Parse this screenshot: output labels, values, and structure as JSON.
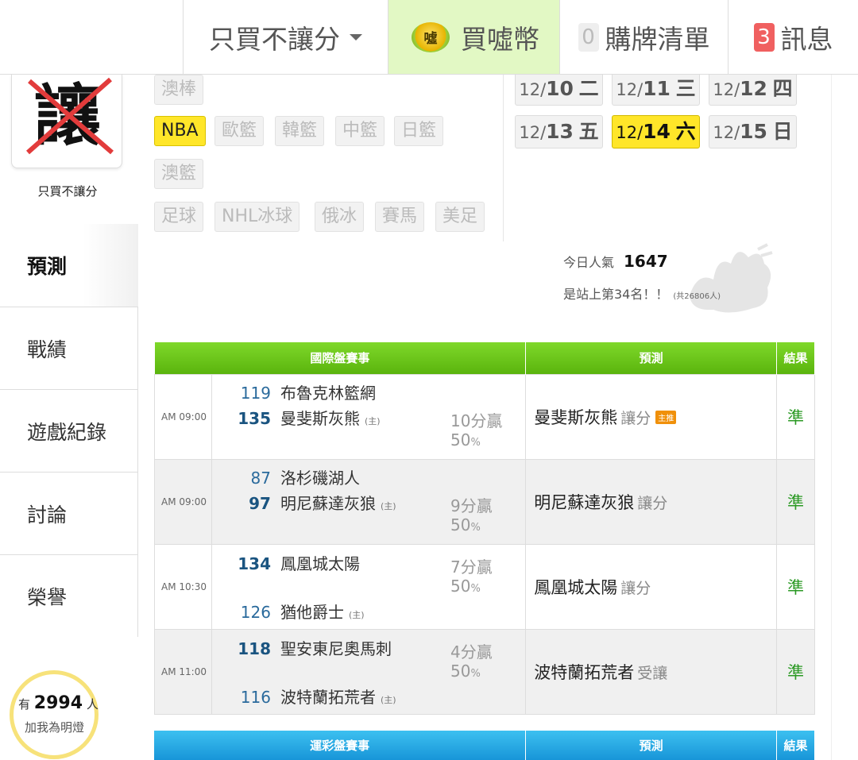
{
  "topbar": {
    "filter_label": "只買不讓分",
    "coin_glyph": "噓",
    "coins_label": "買噓幣",
    "cart_count": "0",
    "cart_label": "購牌清單",
    "msg_count": "3",
    "msg_label": "訊息"
  },
  "sidebar": {
    "logo_char": "讓",
    "logo_caption": "只買不讓分",
    "nav": [
      "預測",
      "戰績",
      "遊戲紀錄",
      "討論",
      "榮譽"
    ],
    "fans_prefix": "有",
    "fans_count": "2994",
    "fans_suffix": "人",
    "fans_cta": "加我為明燈"
  },
  "sports": {
    "row0": [
      "澳棒"
    ],
    "row1": [
      "NBA",
      "歐籃",
      "韓籃",
      "中籃",
      "日籃"
    ],
    "row2": [
      "澳籃"
    ],
    "row3": [
      "足球",
      "NHL冰球",
      "俄冰",
      "賽馬",
      "美足"
    ],
    "active": "NBA"
  },
  "dates": [
    {
      "md": "12/",
      "d": "10",
      "w": "二"
    },
    {
      "md": "12/",
      "d": "11",
      "w": "三"
    },
    {
      "md": "12/",
      "d": "12",
      "w": "四"
    },
    {
      "md": "12/",
      "d": "13",
      "w": "五"
    },
    {
      "md": "12/",
      "d": "14",
      "w": "六",
      "active": true
    },
    {
      "md": "12/",
      "d": "15",
      "w": "日"
    }
  ],
  "popularity": {
    "label": "今日人氣",
    "value": "1647",
    "rank_text": "是站上第34名！！",
    "total_text": "(共26806人)"
  },
  "table": {
    "col_game": "國際盤賽事",
    "col_pred": "預測",
    "col_result": "結果",
    "home_mark": "(主)",
    "top_tag": "主推",
    "rows": [
      {
        "time": "AM 09:00",
        "away_score": "119",
        "away": "布魯克林籃網",
        "home_score": "135",
        "home": "曼斐斯灰熊",
        "winner": "home",
        "margin": "10分贏",
        "pct": "50",
        "pct_unit": "%",
        "pred_team": "曼斐斯灰熊",
        "pred_kind": "讓分",
        "top": true,
        "result": "準"
      },
      {
        "time": "AM 09:00",
        "away_score": "87",
        "away": "洛杉磯湖人",
        "home_score": "97",
        "home": "明尼蘇達灰狼",
        "winner": "home",
        "margin": "9分贏",
        "pct": "50",
        "pct_unit": "%",
        "pred_team": "明尼蘇達灰狼",
        "pred_kind": "讓分",
        "top": false,
        "result": "準"
      },
      {
        "time": "AM 10:30",
        "away_score": "134",
        "away": "鳳凰城太陽",
        "home_score": "126",
        "home": "猶他爵士",
        "winner": "away",
        "margin": "7分贏",
        "pct": "50",
        "pct_unit": "%",
        "pred_team": "鳳凰城太陽",
        "pred_kind": "讓分",
        "top": false,
        "result": "準"
      },
      {
        "time": "AM 11:00",
        "away_score": "118",
        "away": "聖安東尼奧馬刺",
        "home_score": "116",
        "home": "波特蘭拓荒者",
        "winner": "away",
        "margin": "4分贏",
        "pct": "50",
        "pct_unit": "%",
        "pred_team": "波特蘭拓荒者",
        "pred_kind": "受讓",
        "top": false,
        "result": "準"
      }
    ]
  },
  "table2": {
    "col_game": "運彩盤賽事",
    "col_pred": "預測",
    "col_result": "結果"
  },
  "colors": {
    "accent_yellow": "#ffe629",
    "green_header": "#5ab40d",
    "blue_header": "#1895d8",
    "result_green": "#2c9a25",
    "msg_badge": "#f06060"
  }
}
